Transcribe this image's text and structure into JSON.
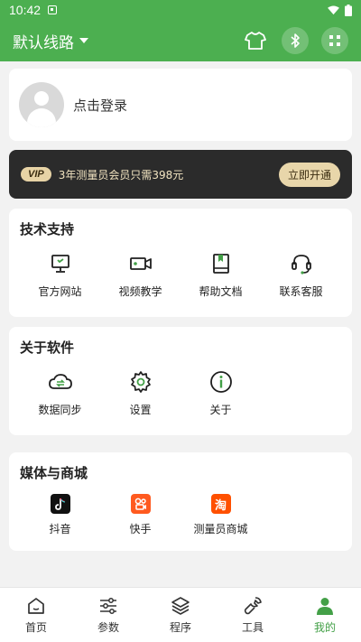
{
  "status_bar": {
    "time": "10:42"
  },
  "app_bar": {
    "route_label": "默认线路"
  },
  "login": {
    "prompt": "点击登录"
  },
  "vip": {
    "badge": "VIP",
    "text": "3年测量员会员只需398元",
    "button": "立即开通"
  },
  "support": {
    "title": "技术支持",
    "items": [
      {
        "label": "官方网站",
        "icon": "monitor-icon"
      },
      {
        "label": "视频教学",
        "icon": "video-camera-icon"
      },
      {
        "label": "帮助文档",
        "icon": "book-icon"
      },
      {
        "label": "联系客服",
        "icon": "headset-icon"
      }
    ]
  },
  "about": {
    "title": "关于软件",
    "items": [
      {
        "label": "数据同步",
        "icon": "cloud-sync-icon"
      },
      {
        "label": "设置",
        "icon": "gear-icon"
      },
      {
        "label": "关于",
        "icon": "info-icon"
      }
    ]
  },
  "media": {
    "title": "媒体与商城",
    "items": [
      {
        "label": "抖音",
        "icon": "douyin-icon"
      },
      {
        "label": "快手",
        "icon": "kuaishou-icon"
      },
      {
        "label": "测量员商城",
        "icon": "taobao-icon",
        "glyph": "淘"
      }
    ]
  },
  "nav": {
    "items": [
      {
        "label": "首页",
        "icon": "home-icon"
      },
      {
        "label": "参数",
        "icon": "sliders-icon"
      },
      {
        "label": "程序",
        "icon": "layers-icon"
      },
      {
        "label": "工具",
        "icon": "wrench-icon"
      },
      {
        "label": "我的",
        "icon": "person-icon",
        "active": true
      }
    ]
  },
  "colors": {
    "primary": "#4caf50",
    "active": "#43a047",
    "vip_bg": "#2b2b2b",
    "vip_gold": "#e7d3a5"
  }
}
